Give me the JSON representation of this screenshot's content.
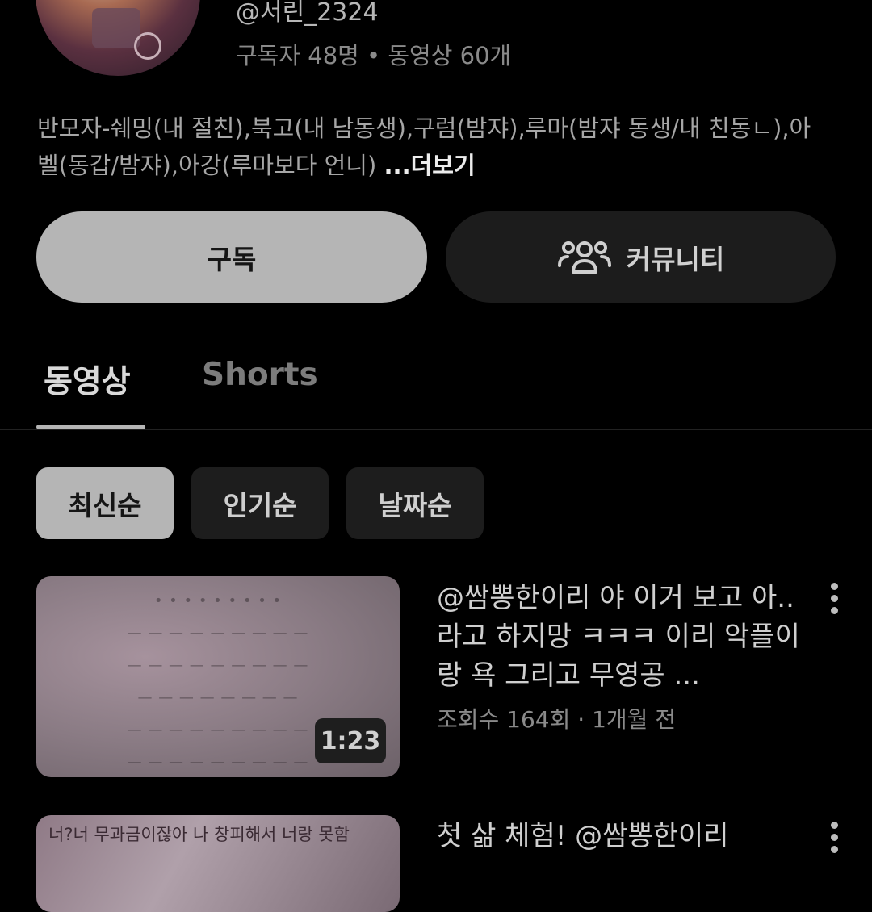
{
  "channel": {
    "handle": "@서린_2324",
    "stats": "구독자 48명 • 동영상 60개",
    "description": "반모자-쉐밍(내 절친),북고(내 남동생),구럼(밤쟈),루마(밤쟈 동생/내 친동ㄴ),아벨(동갑/밤쟈),아강(루마보다 언니) ",
    "description_more": "...더보기"
  },
  "buttons": {
    "subscribe": "구독",
    "community": "커뮤니티"
  },
  "tabs": [
    {
      "label": "동영상",
      "active": true
    },
    {
      "label": "Shorts",
      "active": false
    }
  ],
  "sort_chips": [
    {
      "label": "최신순",
      "selected": true
    },
    {
      "label": "인기순",
      "selected": false
    },
    {
      "label": "날짜순",
      "selected": false
    }
  ],
  "videos": [
    {
      "title": "@쌈뽕한이리 야 이거 보고 아.. 라고 하지망 ㅋㅋㅋ 이리 악플이랑 욕 그리고 무영공 ...",
      "meta": "조회수 164회 · 1개월 전",
      "duration": "1:23"
    },
    {
      "title": " 첫 삶 체험!  @쌈뽕한이리",
      "thumb_text": "너?너 무과금이잖아 나 창피해서 너랑 못함"
    }
  ],
  "colors": {
    "background": "#000000",
    "primary_button": "#b5b5b5",
    "secondary_button": "#1c1c1c"
  },
  "icons": {
    "community": "people-group-icon",
    "more": "vertical-dots-icon"
  }
}
